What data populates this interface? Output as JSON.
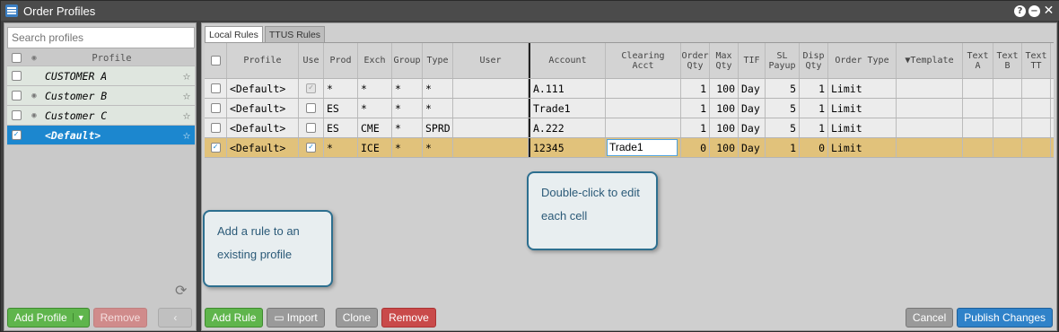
{
  "window": {
    "title": "Order Profiles",
    "help": "?",
    "minimize": "−",
    "close": "✕"
  },
  "left": {
    "search_placeholder": "Search profiles",
    "header": {
      "profile": "Profile"
    },
    "profiles": [
      {
        "name": "CUSTOMER A",
        "checked": false,
        "eye": false,
        "selected": false
      },
      {
        "name": "Customer B",
        "checked": false,
        "eye": true,
        "selected": false
      },
      {
        "name": "Customer C",
        "checked": false,
        "eye": true,
        "selected": false
      },
      {
        "name": "<Default>",
        "checked": true,
        "eye": false,
        "selected": true
      }
    ],
    "buttons": {
      "add_profile": "Add Profile",
      "remove": "Remove",
      "back": "‹"
    }
  },
  "tabs": [
    {
      "label": "Local Rules",
      "active": true
    },
    {
      "label": "TTUS Rules",
      "active": false
    }
  ],
  "grid": {
    "headers": [
      "Profile",
      "Use",
      "Prod",
      "Exch",
      "Group",
      "Type",
      "User",
      "Account",
      "Clearing Acct",
      "Order Qty",
      "Max Qty",
      "TIF",
      "SL Payup",
      "Disp Qty",
      "Order Type",
      "▼Template",
      "Text A",
      "Text B",
      "Text TT"
    ],
    "rows": [
      {
        "profile": "<Default>",
        "use": true,
        "use_disabled": true,
        "prod": "*",
        "exch": "*",
        "group": "*",
        "type": "*",
        "user": "",
        "account": "A.111",
        "clearing": "",
        "order_qty": "1",
        "max_qty": "100",
        "tif": "Day",
        "sl_payup": "5",
        "disp_qty": "1",
        "order_type": "Limit",
        "template": "",
        "text_a": "",
        "text_b": "",
        "text_tt": "",
        "highlight": false
      },
      {
        "profile": "<Default>",
        "use": false,
        "prod": "ES",
        "exch": "*",
        "group": "*",
        "type": "*",
        "user": "",
        "account": "Trade1",
        "clearing": "",
        "order_qty": "1",
        "max_qty": "100",
        "tif": "Day",
        "sl_payup": "5",
        "disp_qty": "1",
        "order_type": "Limit",
        "template": "",
        "text_a": "",
        "text_b": "",
        "text_tt": "",
        "highlight": false
      },
      {
        "profile": "<Default>",
        "use": false,
        "prod": "ES",
        "exch": "CME",
        "group": "*",
        "type": "SPRD",
        "user": "",
        "account": "A.222",
        "clearing": "",
        "order_qty": "1",
        "max_qty": "100",
        "tif": "Day",
        "sl_payup": "5",
        "disp_qty": "1",
        "order_type": "Limit",
        "template": "",
        "text_a": "",
        "text_b": "",
        "text_tt": "",
        "highlight": false
      },
      {
        "profile": "<Default>",
        "use": true,
        "prod": "*",
        "exch": "ICE",
        "group": "*",
        "type": "*",
        "user": "",
        "account": "12345",
        "clearing": "Trade1",
        "order_qty": "0",
        "max_qty": "100",
        "tif": "Day",
        "sl_payup": "1",
        "disp_qty": "0",
        "order_type": "Limit",
        "template": "",
        "text_a": "",
        "text_b": "",
        "text_tt": "",
        "highlight": true
      }
    ]
  },
  "callouts": {
    "edit": "Double-click to edit each cell",
    "add": "Add a rule to an existing profile"
  },
  "bottom": {
    "add_rule": "Add Rule",
    "import": "Import",
    "clone": "Clone",
    "remove": "Remove",
    "cancel": "Cancel",
    "publish": "Publish Changes"
  }
}
